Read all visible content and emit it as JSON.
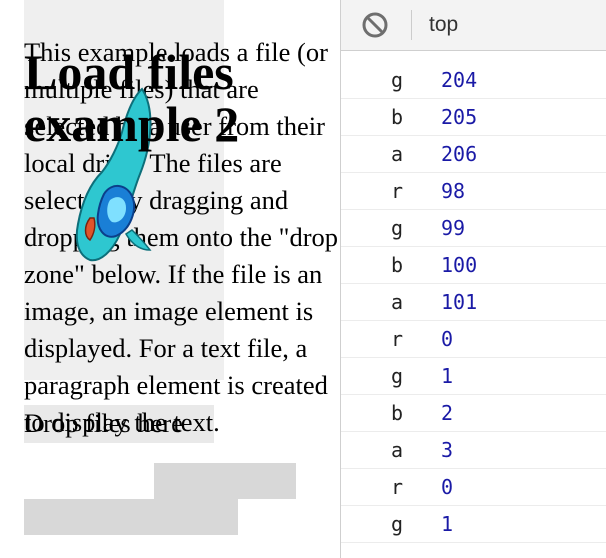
{
  "page": {
    "title": "Load files example 2",
    "intro": "This example loads a file (or multiple files) that are selected by a user from their local drive. The files are selected by dragging and dropping them onto the \"drop zone\" below. If the file is an image, an image element is displayed. For a text file, a paragraph element is created to display the text.",
    "drop_zone_label": "Drop files here",
    "image_icon": "blue-bird-image"
  },
  "devtools": {
    "clear_icon": "clear-console-icon",
    "context": "top",
    "log": [
      {
        "key": "g",
        "value": "204"
      },
      {
        "key": "b",
        "value": "205"
      },
      {
        "key": "a",
        "value": "206"
      },
      {
        "key": "r",
        "value": "98"
      },
      {
        "key": "g",
        "value": "99"
      },
      {
        "key": "b",
        "value": "100"
      },
      {
        "key": "a",
        "value": "101"
      },
      {
        "key": "r",
        "value": "0"
      },
      {
        "key": "g",
        "value": "1"
      },
      {
        "key": "b",
        "value": "2"
      },
      {
        "key": "a",
        "value": "3"
      },
      {
        "key": "r",
        "value": "0"
      },
      {
        "key": "g",
        "value": "1"
      }
    ],
    "value_color": "#1a1aa6"
  }
}
